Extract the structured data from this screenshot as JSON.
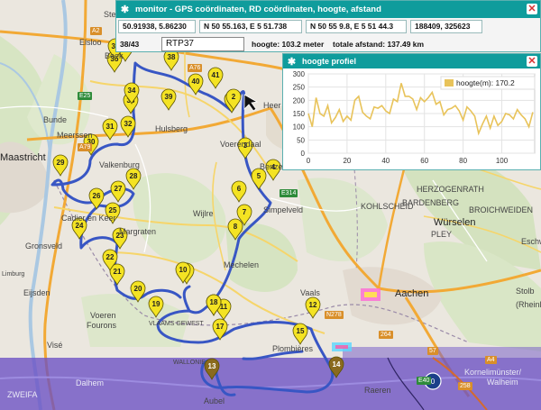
{
  "map": {
    "places": [
      {
        "name": "Stein",
        "cls": ""
      },
      {
        "name": "Elsloo",
        "cls": ""
      },
      {
        "name": "Beek",
        "cls": ""
      },
      {
        "name": "Bunde",
        "cls": ""
      },
      {
        "name": "Meerssen",
        "cls": ""
      },
      {
        "name": "Maastricht",
        "cls": "big"
      },
      {
        "name": "Valkenburg",
        "cls": ""
      },
      {
        "name": "Hulsberg",
        "cls": ""
      },
      {
        "name": "Voerendaal",
        "cls": ""
      },
      {
        "name": "Heer",
        "cls": ""
      },
      {
        "name": "Benze",
        "cls": ""
      },
      {
        "name": "Simpelveld",
        "cls": ""
      },
      {
        "name": "Wijlre",
        "cls": ""
      },
      {
        "name": "Cadier en Keer",
        "cls": ""
      },
      {
        "name": "Margraten",
        "cls": ""
      },
      {
        "name": "Gronsveld",
        "cls": ""
      },
      {
        "name": "Mechelen",
        "cls": ""
      },
      {
        "name": "Eijsden",
        "cls": ""
      },
      {
        "name": "Voeren",
        "cls": ""
      },
      {
        "name": "Fourons",
        "cls": ""
      },
      {
        "name": "Vaals",
        "cls": ""
      },
      {
        "name": "Aachen",
        "cls": "big"
      },
      {
        "name": "Würselen",
        "cls": "big"
      },
      {
        "name": "Eschw",
        "cls": ""
      },
      {
        "name": "Stolb",
        "cls": ""
      },
      {
        "name": "(Rheinla",
        "cls": ""
      },
      {
        "name": "KOHLSCHEID",
        "cls": ""
      },
      {
        "name": "BARDENBERG",
        "cls": ""
      },
      {
        "name": "HERZOGENRATH",
        "cls": ""
      },
      {
        "name": "PLEY",
        "cls": ""
      },
      {
        "name": "BROICHWEIDEN",
        "cls": ""
      },
      {
        "name": "Plombières",
        "cls": ""
      },
      {
        "name": "Visé",
        "cls": ""
      },
      {
        "name": "Dalhem",
        "cls": "light"
      },
      {
        "name": "Aubel",
        "cls": ""
      },
      {
        "name": "Raeren",
        "cls": ""
      },
      {
        "name": "Kornelimünster/",
        "cls": "light"
      },
      {
        "name": "Walheim",
        "cls": "light"
      },
      {
        "name": "ZWEIFA",
        "cls": "light"
      },
      {
        "name": "VLAAMS GEWEST",
        "cls": ""
      },
      {
        "name": "WALLONIE",
        "cls": ""
      },
      {
        "name": "Limburg",
        "cls": ""
      }
    ],
    "roads": [
      "A2",
      "A76",
      "A79",
      "E25",
      "E314",
      "A4",
      "N278",
      "264",
      "258",
      "57",
      "E40",
      "A2",
      "E25"
    ],
    "markers": [
      "1",
      "2",
      "3",
      "4",
      "5",
      "6",
      "7",
      "8",
      "9",
      "10",
      "11",
      "12",
      "13",
      "14",
      "15",
      "16",
      "17",
      "18",
      "19",
      "20",
      "21",
      "22",
      "23",
      "24",
      "25",
      "26",
      "27",
      "28",
      "29",
      "30",
      "31",
      "32",
      "33",
      "34",
      "35",
      "36",
      "37",
      "38",
      "39",
      "40",
      "41"
    ]
  },
  "monitor": {
    "title": "monitor - GPS coördinaten, RD coördinaten, hoogte, afstand",
    "gps": "50.91938, 5.86230",
    "lat_dms": "N 50 55.163, E 5 51.738",
    "lat_dms2": "N 50 55 9.8, E 5 51 44.3",
    "rd": "188409, 325623",
    "segment": "38/43",
    "route_name": "RTP37",
    "height": "hoogte: 103.2 meter",
    "total_distance": "totale afstand: 137.49 km"
  },
  "profile": {
    "title": "hoogte profiel",
    "legend": "hoogte(m): 170.2",
    "line_color": "#e8c35a"
  },
  "chart_data": {
    "type": "line",
    "title": "hoogte profiel",
    "xlabel": "",
    "ylabel": "",
    "xlim": [
      0,
      117
    ],
    "ylim": [
      0,
      300
    ],
    "x_ticks": [
      0,
      20,
      40,
      60,
      80,
      100
    ],
    "y_ticks": [
      0,
      50,
      100,
      150,
      200,
      250,
      300
    ],
    "grid": true,
    "legend_position": "top-right",
    "series": [
      {
        "name": "hoogte(m): 170.2",
        "x": [
          0,
          2,
          4,
          6,
          8,
          10,
          12,
          14,
          16,
          18,
          20,
          22,
          24,
          26,
          28,
          30,
          32,
          34,
          36,
          38,
          40,
          42,
          44,
          46,
          48,
          50,
          52,
          54,
          56,
          58,
          60,
          62,
          64,
          66,
          68,
          70,
          72,
          74,
          76,
          78,
          80,
          82,
          84,
          86,
          88,
          90,
          92,
          94,
          96,
          98,
          100,
          102,
          104,
          106,
          108,
          110,
          112,
          114,
          116
        ],
        "y": [
          150,
          100,
          210,
          150,
          140,
          180,
          115,
          135,
          165,
          120,
          140,
          125,
          200,
          215,
          155,
          140,
          130,
          175,
          170,
          180,
          160,
          150,
          205,
          195,
          265,
          215,
          215,
          205,
          165,
          210,
          195,
          210,
          230,
          185,
          195,
          145,
          165,
          170,
          180,
          160,
          125,
          175,
          160,
          140,
          75,
          110,
          140,
          95,
          140,
          105,
          120,
          150,
          145,
          130,
          165,
          145,
          130,
          100,
          155
        ]
      }
    ]
  }
}
